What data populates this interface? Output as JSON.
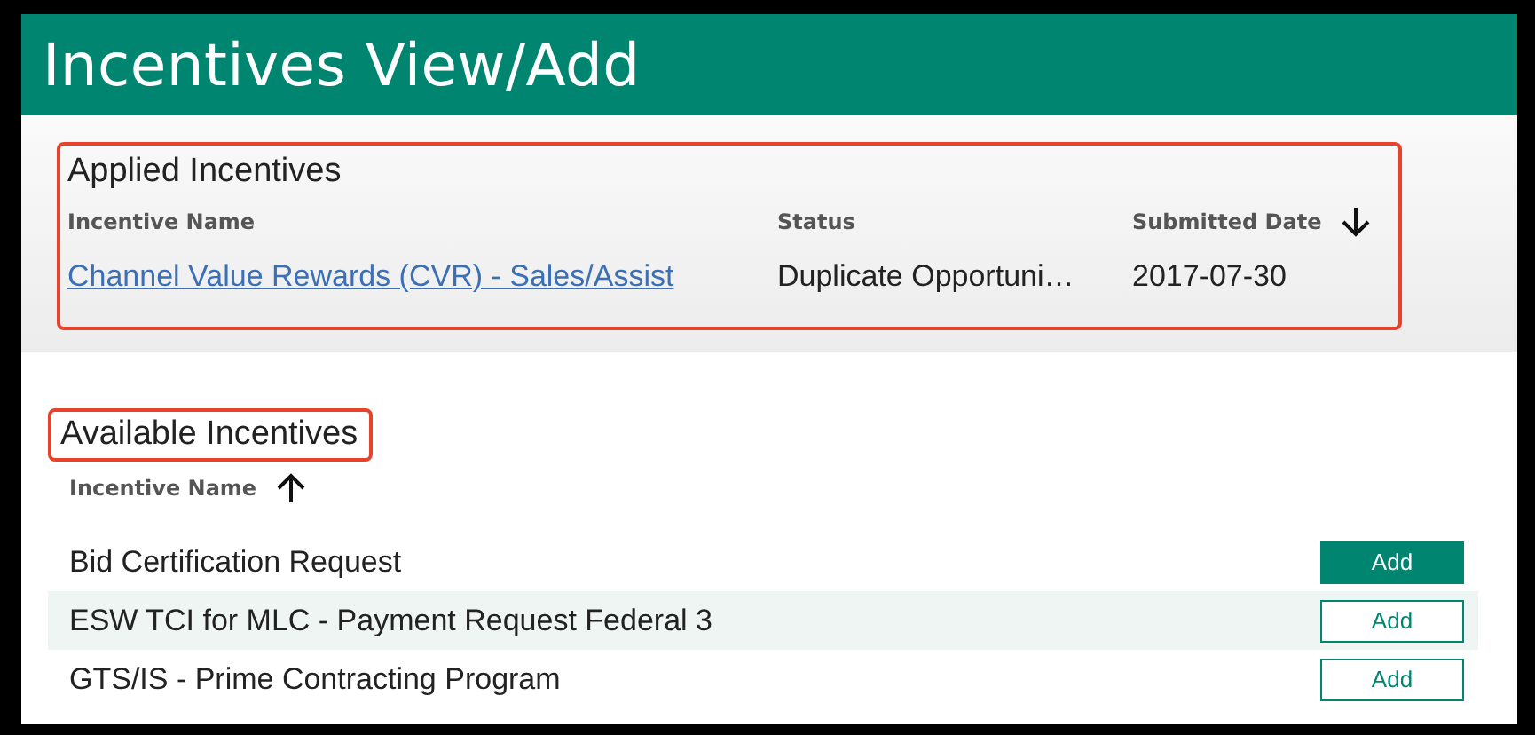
{
  "header": {
    "title": "Incentives View/Add"
  },
  "applied": {
    "title": "Applied Incentives",
    "outlined": true,
    "columns": [
      {
        "label": "Incentive Name"
      },
      {
        "label": "Status"
      },
      {
        "label": "Submitted Date",
        "sorted": true,
        "ascending": false
      }
    ],
    "rows": [
      {
        "name": "Channel Value Rewards (CVR) - Sales/Assist",
        "status": "Duplicate Opportuni…",
        "date": "2017-07-30"
      }
    ]
  },
  "available": {
    "title": "Available Incentives",
    "outlined": true,
    "columns": [
      {
        "label": "Incentive Name",
        "sorted": true,
        "ascending": true
      }
    ],
    "rows": [
      {
        "name": "Bid Certification Request",
        "highlighted": false,
        "button": {
          "label": "Add",
          "filled": true
        }
      },
      {
        "name": "ESW TCI for MLC - Payment Request Federal 3",
        "highlighted": true,
        "button": {
          "label": "Add",
          "filled": false
        }
      },
      {
        "name": "GTS/IS - Prime Contracting Program",
        "highlighted": false,
        "button": {
          "label": "Add",
          "filled": false
        }
      }
    ]
  }
}
